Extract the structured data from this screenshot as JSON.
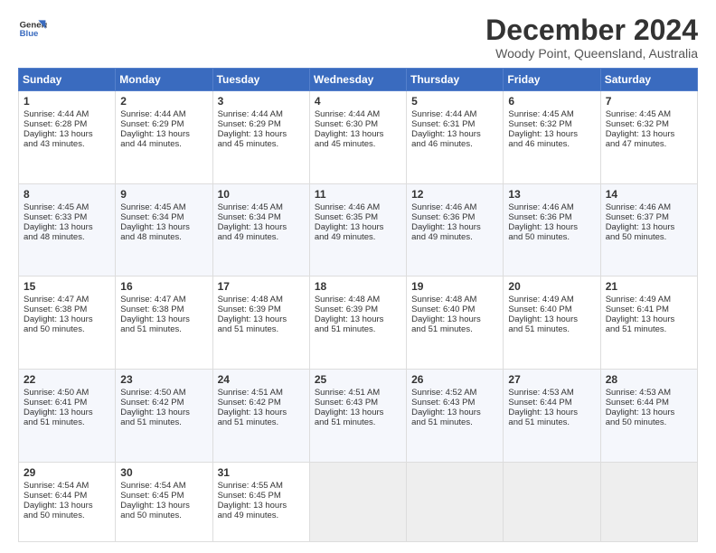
{
  "header": {
    "logo_line1": "General",
    "logo_line2": "Blue",
    "title": "December 2024",
    "subtitle": "Woody Point, Queensland, Australia"
  },
  "days_of_week": [
    "Sunday",
    "Monday",
    "Tuesday",
    "Wednesday",
    "Thursday",
    "Friday",
    "Saturday"
  ],
  "weeks": [
    [
      {
        "day": "1",
        "sunrise": "4:44 AM",
        "sunset": "6:28 PM",
        "daylight": "13 hours and 43 minutes."
      },
      {
        "day": "2",
        "sunrise": "4:44 AM",
        "sunset": "6:29 PM",
        "daylight": "13 hours and 44 minutes."
      },
      {
        "day": "3",
        "sunrise": "4:44 AM",
        "sunset": "6:29 PM",
        "daylight": "13 hours and 45 minutes."
      },
      {
        "day": "4",
        "sunrise": "4:44 AM",
        "sunset": "6:30 PM",
        "daylight": "13 hours and 45 minutes."
      },
      {
        "day": "5",
        "sunrise": "4:44 AM",
        "sunset": "6:31 PM",
        "daylight": "13 hours and 46 minutes."
      },
      {
        "day": "6",
        "sunrise": "4:45 AM",
        "sunset": "6:32 PM",
        "daylight": "13 hours and 46 minutes."
      },
      {
        "day": "7",
        "sunrise": "4:45 AM",
        "sunset": "6:32 PM",
        "daylight": "13 hours and 47 minutes."
      }
    ],
    [
      {
        "day": "8",
        "sunrise": "4:45 AM",
        "sunset": "6:33 PM",
        "daylight": "13 hours and 48 minutes."
      },
      {
        "day": "9",
        "sunrise": "4:45 AM",
        "sunset": "6:34 PM",
        "daylight": "13 hours and 48 minutes."
      },
      {
        "day": "10",
        "sunrise": "4:45 AM",
        "sunset": "6:34 PM",
        "daylight": "13 hours and 49 minutes."
      },
      {
        "day": "11",
        "sunrise": "4:46 AM",
        "sunset": "6:35 PM",
        "daylight": "13 hours and 49 minutes."
      },
      {
        "day": "12",
        "sunrise": "4:46 AM",
        "sunset": "6:36 PM",
        "daylight": "13 hours and 49 minutes."
      },
      {
        "day": "13",
        "sunrise": "4:46 AM",
        "sunset": "6:36 PM",
        "daylight": "13 hours and 50 minutes."
      },
      {
        "day": "14",
        "sunrise": "4:46 AM",
        "sunset": "6:37 PM",
        "daylight": "13 hours and 50 minutes."
      }
    ],
    [
      {
        "day": "15",
        "sunrise": "4:47 AM",
        "sunset": "6:38 PM",
        "daylight": "13 hours and 50 minutes."
      },
      {
        "day": "16",
        "sunrise": "4:47 AM",
        "sunset": "6:38 PM",
        "daylight": "13 hours and 51 minutes."
      },
      {
        "day": "17",
        "sunrise": "4:48 AM",
        "sunset": "6:39 PM",
        "daylight": "13 hours and 51 minutes."
      },
      {
        "day": "18",
        "sunrise": "4:48 AM",
        "sunset": "6:39 PM",
        "daylight": "13 hours and 51 minutes."
      },
      {
        "day": "19",
        "sunrise": "4:48 AM",
        "sunset": "6:40 PM",
        "daylight": "13 hours and 51 minutes."
      },
      {
        "day": "20",
        "sunrise": "4:49 AM",
        "sunset": "6:40 PM",
        "daylight": "13 hours and 51 minutes."
      },
      {
        "day": "21",
        "sunrise": "4:49 AM",
        "sunset": "6:41 PM",
        "daylight": "13 hours and 51 minutes."
      }
    ],
    [
      {
        "day": "22",
        "sunrise": "4:50 AM",
        "sunset": "6:41 PM",
        "daylight": "13 hours and 51 minutes."
      },
      {
        "day": "23",
        "sunrise": "4:50 AM",
        "sunset": "6:42 PM",
        "daylight": "13 hours and 51 minutes."
      },
      {
        "day": "24",
        "sunrise": "4:51 AM",
        "sunset": "6:42 PM",
        "daylight": "13 hours and 51 minutes."
      },
      {
        "day": "25",
        "sunrise": "4:51 AM",
        "sunset": "6:43 PM",
        "daylight": "13 hours and 51 minutes."
      },
      {
        "day": "26",
        "sunrise": "4:52 AM",
        "sunset": "6:43 PM",
        "daylight": "13 hours and 51 minutes."
      },
      {
        "day": "27",
        "sunrise": "4:53 AM",
        "sunset": "6:44 PM",
        "daylight": "13 hours and 51 minutes."
      },
      {
        "day": "28",
        "sunrise": "4:53 AM",
        "sunset": "6:44 PM",
        "daylight": "13 hours and 50 minutes."
      }
    ],
    [
      {
        "day": "29",
        "sunrise": "4:54 AM",
        "sunset": "6:44 PM",
        "daylight": "13 hours and 50 minutes."
      },
      {
        "day": "30",
        "sunrise": "4:54 AM",
        "sunset": "6:45 PM",
        "daylight": "13 hours and 50 minutes."
      },
      {
        "day": "31",
        "sunrise": "4:55 AM",
        "sunset": "6:45 PM",
        "daylight": "13 hours and 49 minutes."
      },
      null,
      null,
      null,
      null
    ]
  ],
  "labels": {
    "sunrise": "Sunrise:",
    "sunset": "Sunset:",
    "daylight": "Daylight:"
  }
}
